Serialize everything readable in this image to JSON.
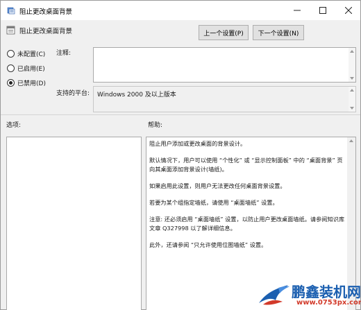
{
  "window": {
    "title": "阻止更改桌面背景",
    "controls": {
      "minimize": "—",
      "maximize": "☐",
      "close": "✕"
    }
  },
  "header": {
    "policy_name": "阻止更改桌面背景",
    "prev_button": "上一个设置(P)",
    "next_button": "下一个设置(N)"
  },
  "state_options": [
    {
      "label": "未配置(C)",
      "checked": false
    },
    {
      "label": "已启用(E)",
      "checked": false
    },
    {
      "label": "已禁用(D)",
      "checked": true
    }
  ],
  "comment": {
    "label": "注释:",
    "value": ""
  },
  "platform": {
    "label": "支持的平台:",
    "value": "Windows 2000 及以上版本"
  },
  "options": {
    "label": "选项:"
  },
  "help": {
    "label": "帮助:",
    "paragraphs": [
      "阻止用户添加或更改桌面的背景设计。",
      "默认情况下，用户可以使用 “个性化” 或 “显示控制面板” 中的 “桌面背景” 页向其桌面添加背景设计(墙纸)。",
      "如果启用此设置，则用户无法更改任何桌面背景设置。",
      "若要为某个组指定墙纸，请使用 “桌面墙纸” 设置。",
      "注意: 还必须启用 “桌面墙纸” 设置，以防止用户更改桌面墙纸。请参阅知识库文章 Q327998 以了解详细信息。",
      "此外，还请参阅 “只允许使用位图墙纸” 设置。"
    ]
  },
  "watermark": {
    "brand": "鹏鑫装机网",
    "url": "www.0753px.com"
  },
  "colors": {
    "accent": "#1b5fb0",
    "watermark_url": "#d23a2a",
    "dialog_bg": "#f0f0f0"
  }
}
